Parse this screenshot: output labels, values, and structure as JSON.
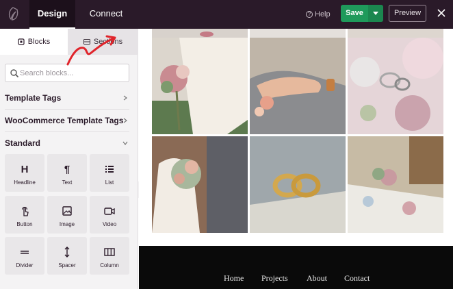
{
  "topbar": {
    "tabs": [
      {
        "label": "Design",
        "active": true
      },
      {
        "label": "Connect",
        "active": false
      }
    ],
    "help_label": "Help",
    "save_label": "Save",
    "preview_label": "Preview",
    "accent_save": "#1f9a5b",
    "bg": "#2a1a29"
  },
  "sidebar": {
    "tabs": [
      {
        "label": "Blocks",
        "icon": "blocks-icon",
        "active": true
      },
      {
        "label": "Sections",
        "icon": "sections-icon",
        "active": false
      }
    ],
    "search": {
      "placeholder": "Search blocks..."
    },
    "groups": [
      {
        "label": "Template Tags",
        "expanded": false
      },
      {
        "label": "WooCommerce Template Tags",
        "expanded": false
      },
      {
        "label": "Standard",
        "expanded": true
      }
    ],
    "blocks": [
      {
        "label": "Headline",
        "icon": "headline-icon"
      },
      {
        "label": "Text",
        "icon": "paragraph-icon"
      },
      {
        "label": "List",
        "icon": "list-icon"
      },
      {
        "label": "Button",
        "icon": "pointer-icon"
      },
      {
        "label": "Image",
        "icon": "image-icon"
      },
      {
        "label": "Video",
        "icon": "video-icon"
      },
      {
        "label": "Divider",
        "icon": "divider-icon"
      },
      {
        "label": "Spacer",
        "icon": "spacer-icon"
      },
      {
        "label": "Column",
        "icon": "column-icon"
      }
    ]
  },
  "canvas": {
    "gallery": [
      {
        "name": "bride-bouquet-photo"
      },
      {
        "name": "holding-hands-rings-photo"
      },
      {
        "name": "rings-on-flowers-photo"
      },
      {
        "name": "couple-bouquet-photo"
      },
      {
        "name": "gold-rings-photo"
      },
      {
        "name": "reception-table-photo"
      }
    ],
    "footer_nav": [
      "Home",
      "Projects",
      "About",
      "Contact"
    ]
  },
  "annotation": {
    "color": "#e0242b"
  }
}
